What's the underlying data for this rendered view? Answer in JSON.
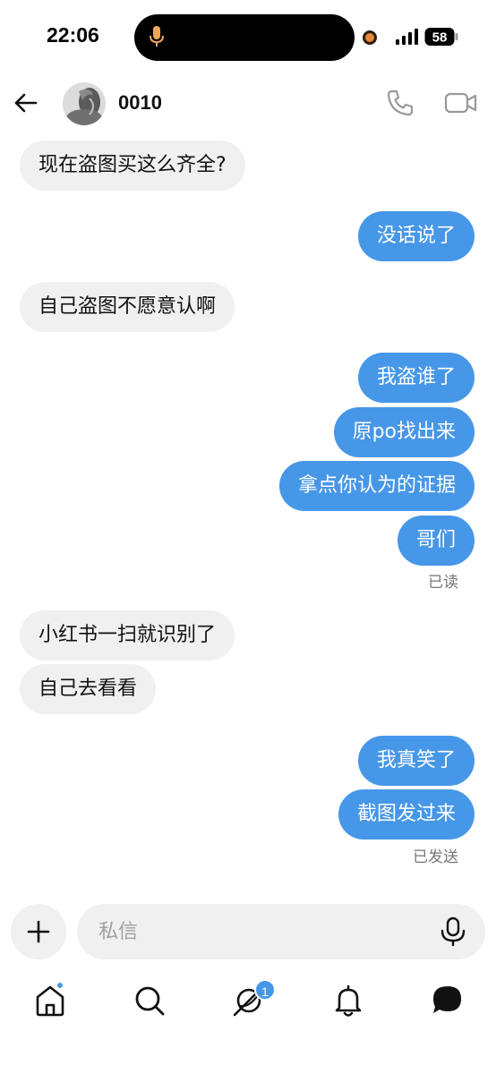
{
  "status_bar": {
    "time": "22:06",
    "battery": "58",
    "accent_mic": "#f2a65a"
  },
  "header": {
    "back_icon": "arrow-left-icon",
    "contact_name": "0010",
    "phone_icon": "phone-icon",
    "video_icon": "video-camera-icon"
  },
  "messages": [
    {
      "direction": "in",
      "text": "现在盗图买这么齐全?"
    },
    {
      "direction": "out",
      "text": "没话说了"
    },
    {
      "direction": "in",
      "text": "自己盗图不愿意认啊"
    },
    {
      "direction": "out",
      "text": "我盗谁了"
    },
    {
      "direction": "out",
      "text": "原po找出来"
    },
    {
      "direction": "out",
      "text": "拿点你认为的证据"
    },
    {
      "direction": "out",
      "text": "哥们"
    },
    {
      "direction": "in",
      "text": "小红书一扫就识别了"
    },
    {
      "direction": "in",
      "text": "自己去看看"
    },
    {
      "direction": "out",
      "text": "我真笑了"
    },
    {
      "direction": "out",
      "text": "截图发过来"
    }
  ],
  "receipts": {
    "read": "已读",
    "sent": "已发送"
  },
  "composer": {
    "placeholder": "私信",
    "plus_icon": "plus-icon",
    "voice_icon": "microphone-icon"
  },
  "nav": {
    "items": [
      "home-icon",
      "search-icon",
      "explore-icon",
      "bell-icon",
      "messages-icon"
    ],
    "explore_badge": "1"
  },
  "colors": {
    "outgoing_bubble": "#4797e8",
    "incoming_bubble": "#f0f0f0",
    "receipt_text": "#777777"
  }
}
